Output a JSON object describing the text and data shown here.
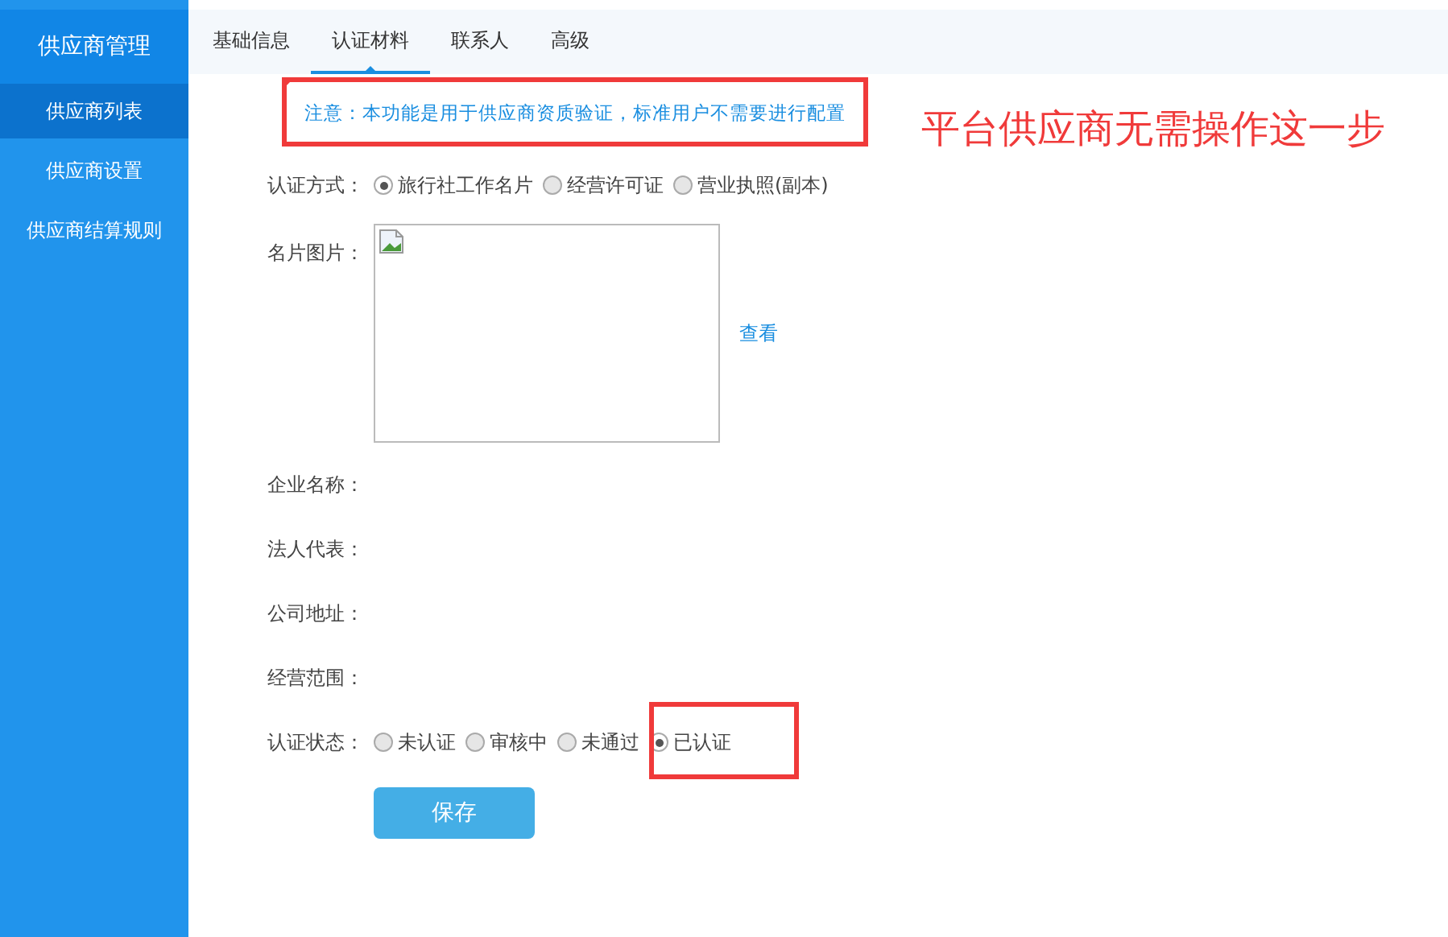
{
  "sidebar": {
    "title": "供应商管理",
    "items": [
      {
        "label": "供应商列表",
        "selected": true
      },
      {
        "label": "供应商设置",
        "selected": false
      },
      {
        "label": "供应商结算规则",
        "selected": false
      }
    ]
  },
  "tabs": [
    {
      "label": "基础信息",
      "selected": false
    },
    {
      "label": "认证材料",
      "selected": true
    },
    {
      "label": "联系人",
      "selected": false
    },
    {
      "label": "高级",
      "selected": false
    }
  ],
  "notice": "注意：本功能是用于供应商资质验证，标准用户不需要进行配置",
  "annotation": "平台供应商无需操作这一步",
  "form": {
    "method": {
      "label": "认证方式：",
      "options": [
        {
          "label": "旅行社工作名片",
          "selected": true
        },
        {
          "label": "经营许可证",
          "selected": false
        },
        {
          "label": "营业执照(副本)",
          "selected": false
        }
      ]
    },
    "image": {
      "label": "名片图片：",
      "link": "查看"
    },
    "fields": [
      {
        "label": "企业名称："
      },
      {
        "label": "法人代表："
      },
      {
        "label": "公司地址："
      },
      {
        "label": "经营范围："
      }
    ],
    "status": {
      "label": "认证状态：",
      "options": [
        {
          "label": "未认证",
          "selected": false
        },
        {
          "label": "审核中",
          "selected": false
        },
        {
          "label": "未通过",
          "selected": false
        },
        {
          "label": "已认证",
          "selected": true
        }
      ]
    },
    "save": "保存"
  }
}
